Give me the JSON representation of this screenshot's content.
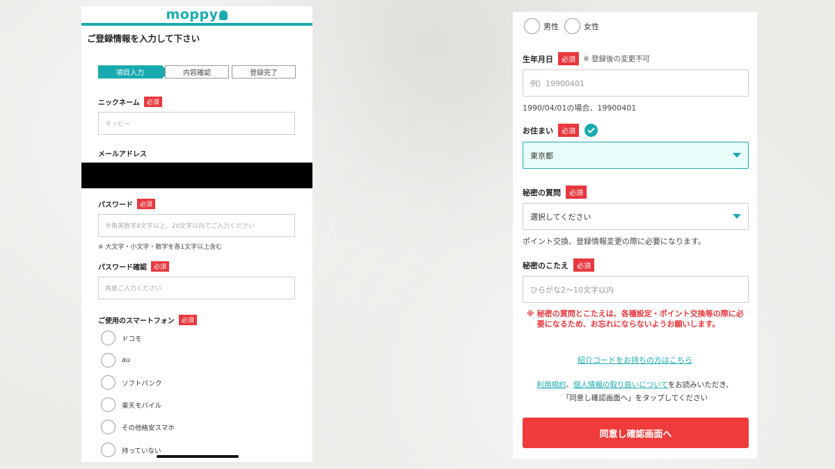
{
  "left": {
    "logo": "moppy",
    "page_title": "ご登録情報を入力して下さい",
    "steps": [
      "項目入力",
      "内容確認",
      "登録完了"
    ],
    "required_label": "必須",
    "nickname": {
      "label": "ニックネーム",
      "placeholder": "モッピー"
    },
    "email": {
      "label": "メールアドレス"
    },
    "password": {
      "label": "パスワード",
      "placeholder": "半角英数字8文字以上、20文字以内でご入力ください",
      "note": "※ 大文字・小文字・数字を各1文字以上含む"
    },
    "password_confirm": {
      "label": "パスワード確認",
      "placeholder": "再度ご入力ください"
    },
    "smartphone": {
      "label": "ご使用のスマートフォン",
      "options": [
        "ドコモ",
        "au",
        "ソフトバンク",
        "楽天モバイル",
        "その他格安スマホ",
        "持っていない"
      ]
    }
  },
  "right": {
    "gender_options": [
      "男性",
      "女性"
    ],
    "required_label": "必須",
    "birthday": {
      "label": "生年月日",
      "note": "※ 登録後の変更不可",
      "placeholder": "例）19900401",
      "hint": "1990/04/01の場合、19900401"
    },
    "residence": {
      "label": "お住まい",
      "value": "東京都"
    },
    "secret_question": {
      "label": "秘密の質問",
      "value": "選択してください",
      "hint": "ポイント交換、登録情報変更の際に必要になります。"
    },
    "secret_answer": {
      "label": "秘密のこたえ",
      "placeholder": "ひらがな2〜10文字以内"
    },
    "warning_mark": "※",
    "warning": "秘密の質問とこたえは、各種設定・ポイント交換等の際に必要になるため、お忘れにならないようお願いします。",
    "referral_link": "紹介コードをお持ちの方はこちら",
    "terms_link": "利用規約",
    "separator": "、",
    "privacy_link": "個人情報の取り扱いについて",
    "agree_text_1": "をお読みいただき、",
    "agree_text_2": "「同意し確認画面へ」をタップしてください",
    "cta": "同意し確認画面へ"
  }
}
